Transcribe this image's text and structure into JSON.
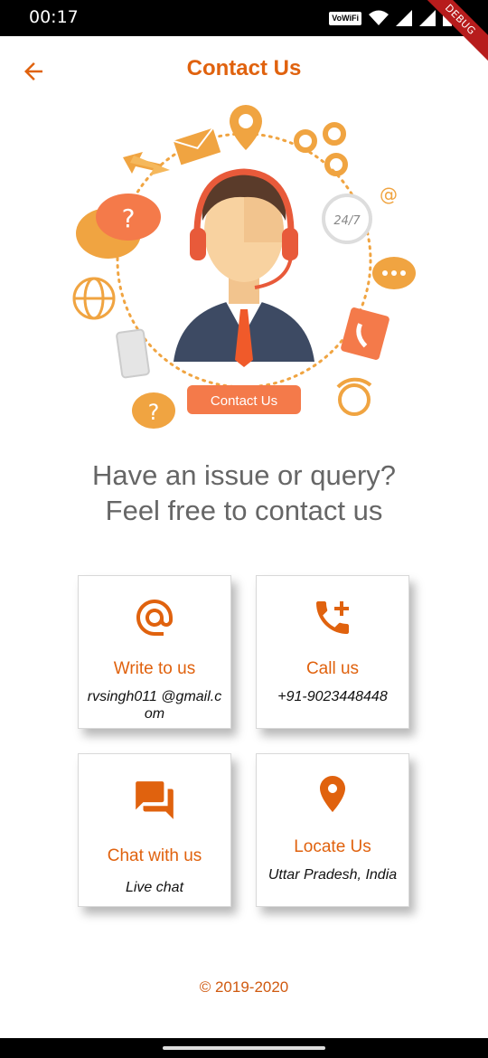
{
  "status_bar": {
    "time": "00:17",
    "network_badge": "VoWiFi",
    "debug_banner": "DEBUG"
  },
  "header": {
    "title": "Contact Us",
    "back_icon": "arrow-back-icon"
  },
  "illustration": {
    "badge_label": "Contact Us",
    "clock_label": "24/7"
  },
  "tagline": {
    "line1": "Have an issue or query?",
    "line2": "Feel free to contact us"
  },
  "cards": {
    "write": {
      "icon": "at-sign-icon",
      "title": "Write to us",
      "detail": "rvsingh011 @gmail.com"
    },
    "call": {
      "icon": "add-call-icon",
      "title": "Call us",
      "detail": "+91-9023448448"
    },
    "chat": {
      "icon": "forum-icon",
      "title": "Chat with us",
      "detail": "Live chat"
    },
    "locate": {
      "icon": "location-pin-icon",
      "title": "Locate Us",
      "detail": "Uttar Pradesh, India"
    }
  },
  "footer": {
    "copyright": "© 2019-2020"
  },
  "colors": {
    "accent": "#e0620e",
    "illustration_orange": "#f0a441",
    "text_gray": "#666666"
  }
}
